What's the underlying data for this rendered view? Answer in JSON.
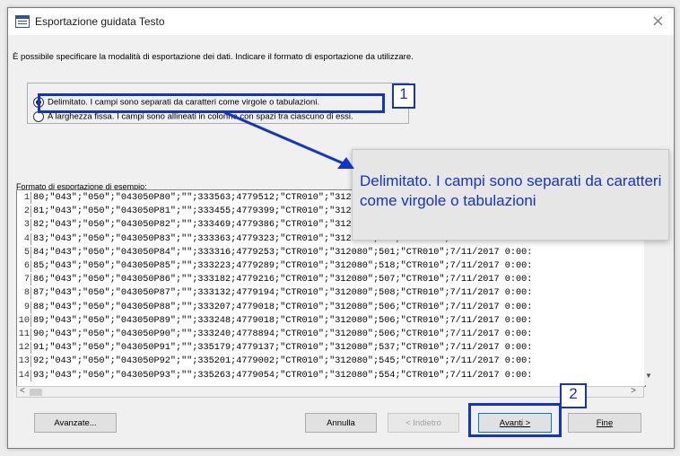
{
  "window": {
    "title": "Esportazione guidata Testo",
    "close_glyph": "×"
  },
  "instruction": "È possibile specificare la modalità di esportazione dei dati. Indicare il formato di esportazione da utilizzare.",
  "options": {
    "delimited": "Delimitato. I campi sono separati da caratteri come virgole o tabulazioni.",
    "fixed": "A larghezza fissa. I campi sono allineati in colonne con spazi tra ciascuno di essi."
  },
  "annotations": {
    "badge1": "1",
    "badge2": "2",
    "callout": "Delimitato. I campi sono separati da caratteri come virgole o tabulazioni",
    "accent_color": "#1433c8"
  },
  "sample": {
    "label": "Formato di esportazione di esempio:",
    "rows": [
      {
        "num": "1",
        "text": "80;\"043\";\"050\";\"043050P80\";\"\";333563;4779512;\"CTR010\";\"312080\";501;\"CTR010\";7/11/2017 0:00:"
      },
      {
        "num": "2",
        "text": "81;\"043\";\"050\";\"043050P81\";\"\";333455;4779399;\"CTR010\";\"312080\";501;\"CTR010\";7/11/2017 0:00:"
      },
      {
        "num": "3",
        "text": "82;\"043\";\"050\";\"043050P82\";\"\";333469;4779386;\"CTR010\";\"312080\";501;\"CTR010\";7/11/2017 0:00:"
      },
      {
        "num": "4",
        "text": "83;\"043\";\"050\";\"043050P83\";\"\";333363;4779323;\"CTR010\";\"312080\";501;\"CTR010\";7/11/2017 0:00:"
      },
      {
        "num": "5",
        "text": "84;\"043\";\"050\";\"043050P84\";\"\";333316;4779253;\"CTR010\";\"312080\";501;\"CTR010\";7/11/2017 0:00:"
      },
      {
        "num": "6",
        "text": "85;\"043\";\"050\";\"043050P85\";\"\";333223;4779289;\"CTR010\";\"312080\";518;\"CTR010\";7/11/2017 0:00:"
      },
      {
        "num": "7",
        "text": "86;\"043\";\"050\";\"043050P86\";\"\";333182;4779216;\"CTR010\";\"312080\";507;\"CTR010\";7/11/2017 0:00:"
      },
      {
        "num": "8",
        "text": "87;\"043\";\"050\";\"043050P87\";\"\";333132;4779194;\"CTR010\";\"312080\";508;\"CTR010\";7/11/2017 0:00:"
      },
      {
        "num": "9",
        "text": "88;\"043\";\"050\";\"043050P88\";\"\";333207;4779018;\"CTR010\";\"312080\";506;\"CTR010\";7/11/2017 0:00:"
      },
      {
        "num": "10",
        "text": "89;\"043\";\"050\";\"043050P89\";\"\";333248;4779018;\"CTR010\";\"312080\";506;\"CTR010\";7/11/2017 0:00:"
      },
      {
        "num": "11",
        "text": "90;\"043\";\"050\";\"043050P90\";\"\";333240;4778894;\"CTR010\";\"312080\";506;\"CTR010\";7/11/2017 0:00:"
      },
      {
        "num": "12",
        "text": "91;\"043\";\"050\";\"043050P91\";\"\";335179;4779137;\"CTR010\";\"312080\";537;\"CTR010\";7/11/2017 0:00:"
      },
      {
        "num": "13",
        "text": "92;\"043\";\"050\";\"043050P92\";\"\";335201;4779002;\"CTR010\";\"312080\";545;\"CTR010\";7/11/2017 0:00:"
      },
      {
        "num": "14",
        "text": "93;\"043\";\"050\";\"043050P93\";\"\";335263;4779054;\"CTR010\";\"312080\";554;\"CTR010\";7/11/2017 0:00:"
      }
    ]
  },
  "scroll": {
    "left_arrow": "<",
    "right_arrow": ">",
    "down_arrow": "▼"
  },
  "buttons": {
    "advanced": "Avanzate...",
    "cancel": "Annulla",
    "back": "< Indietro",
    "next": "Avanti >",
    "finish": "Fine"
  }
}
